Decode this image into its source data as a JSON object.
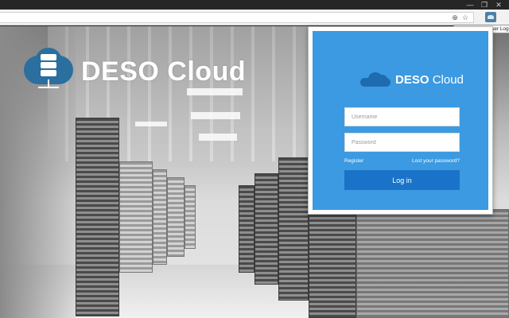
{
  "window": {
    "minimize_glyph": "—",
    "restore_glyph": "❐",
    "close_glyph": "✕"
  },
  "toolbar": {
    "zoom_icon": "magnifier-icon",
    "zoom_glyph": "⊕",
    "bookmark_icon": "star-icon",
    "bookmark_glyph": "☆",
    "extension_icon": "deso-cloud-extension-icon"
  },
  "tooltip": {
    "text": "Deso Cloud | User Login"
  },
  "background": {
    "brand_name": "DESO Cloud",
    "brand_color": "#2a6f9e"
  },
  "login": {
    "logo_bold": "DESO",
    "logo_rest": "Cloud",
    "username_placeholder": "Username",
    "password_placeholder": "Password",
    "register_label": "Register",
    "lost_password_label": "Lost your password?",
    "login_label": "Log in",
    "panel_color": "#3b9ae1",
    "button_color": "#1a73c9"
  }
}
